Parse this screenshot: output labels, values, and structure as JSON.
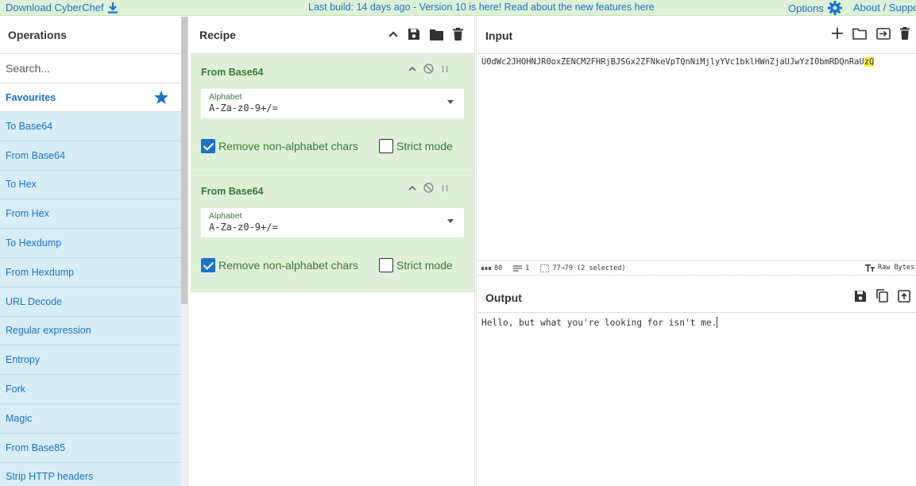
{
  "banner": {
    "download_label": "Download CyberChef",
    "notice": "Last build: 14 days ago - Version 10 is here! Read about the new features here",
    "options_label": "Options",
    "about_label": "About / Suppo"
  },
  "operations": {
    "title": "Operations",
    "search_placeholder": "Search...",
    "favourites_label": "Favourites",
    "items": [
      "To Base64",
      "From Base64",
      "To Hex",
      "From Hex",
      "To Hexdump",
      "From Hexdump",
      "URL Decode",
      "Regular expression",
      "Entropy",
      "Fork",
      "Magic",
      "From Base85",
      "Strip HTTP headers"
    ]
  },
  "recipe": {
    "title": "Recipe",
    "ingredients": [
      {
        "name": "From Base64",
        "alphabet_label": "Alphabet",
        "alphabet_value": "A-Za-z0-9+/=",
        "remove_label": "Remove non-alphabet chars",
        "remove_checked": true,
        "strict_label": "Strict mode",
        "strict_checked": false
      },
      {
        "name": "From Base64",
        "alphabet_label": "Alphabet",
        "alphabet_value": "A-Za-z0-9+/=",
        "remove_label": "Remove non-alphabet chars",
        "remove_checked": true,
        "strict_label": "Strict mode",
        "strict_checked": false
      }
    ]
  },
  "input": {
    "title": "Input",
    "text_main": "U0dWc2JHOHNJR0oxZENCM2FHRjBJSGx2ZFNkeVpTQnNiMjlyYVc1bklHWnZjaUJwYzI0bmRDQnRaU",
    "text_selected": "zQ",
    "status": {
      "length": "80",
      "lines": "1",
      "selection": "77→79 (2 selected)",
      "raw_bytes": "Raw Bytes"
    }
  },
  "output": {
    "title": "Output",
    "text": "Hello, but what you're looking for isn't me."
  },
  "colors": {
    "accent": "#1a73c7",
    "recipe_bg": "#dff0d8",
    "op_item_bg": "#d9edf7",
    "highlight": "#ffeb3b"
  }
}
